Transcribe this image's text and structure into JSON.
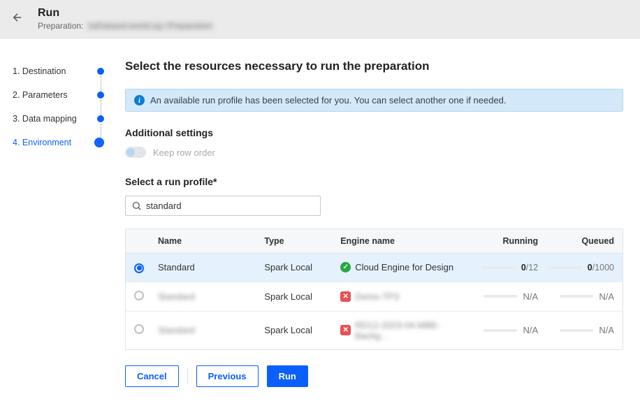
{
  "header": {
    "title": "Run",
    "prep_label": "Preparation:",
    "prep_value": "talDataset-world.ug / Preparation"
  },
  "steps": [
    {
      "index": "1.",
      "label": "Destination"
    },
    {
      "index": "2.",
      "label": "Parameters"
    },
    {
      "index": "3.",
      "label": "Data mapping"
    },
    {
      "index": "4.",
      "label": "Environment"
    }
  ],
  "main": {
    "title": "Select the resources necessary to run the preparation",
    "info_banner": "An available run profile has been selected for you. You can select another one if needed.",
    "additional_label": "Additional settings",
    "toggle_label": "Keep row order",
    "select_profile_label": "Select a run profile*",
    "search_value": "standard"
  },
  "table": {
    "headers": {
      "name": "Name",
      "type": "Type",
      "engine": "Engine name",
      "running": "Running",
      "queued": "Queued"
    },
    "rows": [
      {
        "selected": true,
        "name": "Standard",
        "type": "Spark Local",
        "engine_status": "ok",
        "engine": "Cloud Engine for Design",
        "running": "0",
        "running_denom": "/12",
        "queued": "0",
        "queued_denom": "/1000"
      },
      {
        "selected": false,
        "name": "Standard",
        "type": "Spark Local",
        "engine_status": "err",
        "engine": "Demo-TP3",
        "running_na": "N/A",
        "queued_na": "N/A"
      },
      {
        "selected": false,
        "name": "Standard",
        "type": "Spark Local",
        "engine_status": "err",
        "engine": "RD12-2023-04-MBE-Backg...",
        "running_na": "N/A",
        "queued_na": "N/A"
      }
    ]
  },
  "actions": {
    "cancel": "Cancel",
    "previous": "Previous",
    "run": "Run"
  }
}
